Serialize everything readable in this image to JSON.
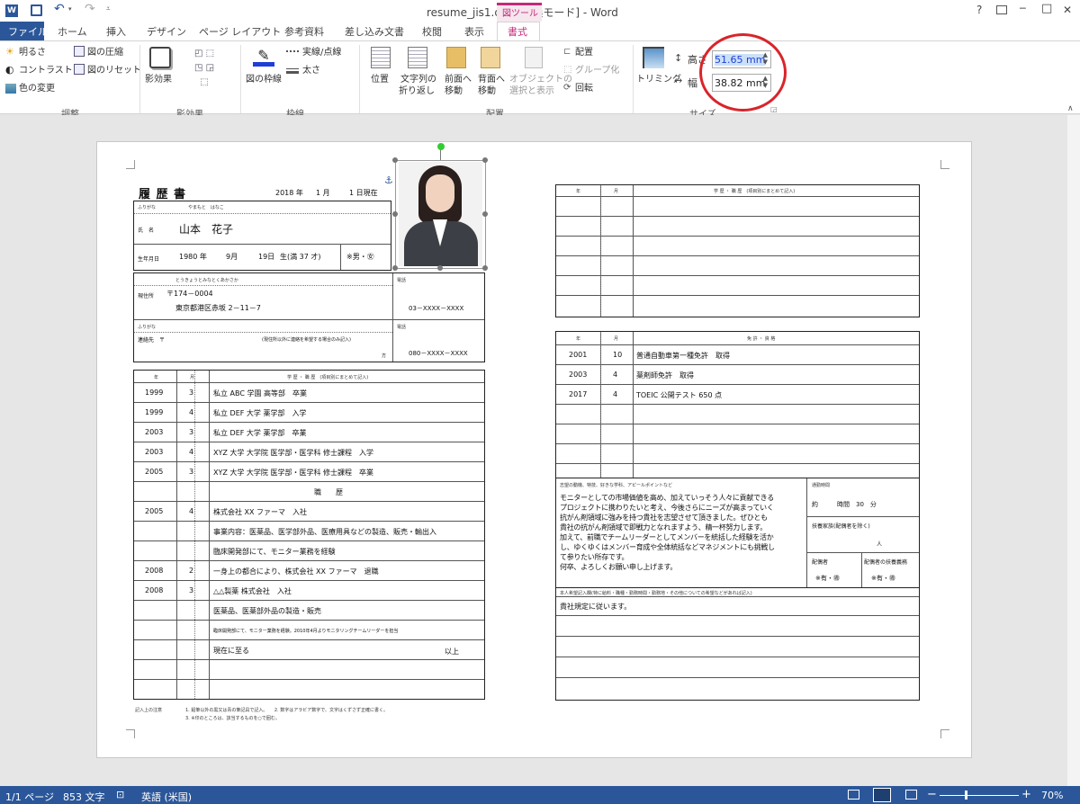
{
  "window": {
    "title": "resume_jis1.doc [互換モード] - Word",
    "help": "?",
    "min": "─",
    "max": "□",
    "close": "✕"
  },
  "tabs": {
    "file": "ファイル",
    "home": "ホーム",
    "insert": "挿入",
    "design": "デザイン",
    "layout": "ページ レイアウト",
    "references": "参考資料",
    "mailings": "差し込み文書",
    "review": "校閲",
    "view": "表示",
    "context": "図ツール",
    "format": "書式"
  },
  "ribbon": {
    "brightness": "明るさ",
    "contrast": "コントラスト",
    "recolor": "色の変更",
    "compress": "図の圧縮",
    "reset": "図のリセット",
    "grp_adjust": "調整",
    "effects": "影効果",
    "grp_shadow": "影効果",
    "border": "図の枠線",
    "line_style": "実線/点線",
    "weight": "太さ",
    "grp_border": "枠線",
    "position": "位置",
    "wrap1": "文字列の",
    "wrap2": "折り返し",
    "fwd1": "前面へ",
    "fwd2": "移動",
    "back1": "背面へ",
    "back2": "移動",
    "sel1": "オブジェクトの",
    "sel2": "選択と表示",
    "align": "配置",
    "group": "グループ化",
    "rotate": "回転",
    "grp_arrange": "配置",
    "crop": "トリミング",
    "height_label": "高さ",
    "width_label": "幅",
    "height_value": "51.65 mm",
    "width_value": "38.82 mm",
    "grp_size": "サイズ"
  },
  "status": {
    "page": "1/1 ページ",
    "words": "853 文字",
    "lang": "英語 (米国)",
    "zoom": "70%"
  },
  "resume": {
    "title": "履 歴 書",
    "date_year": "2018 年",
    "date_month": "1 月",
    "date_day": "1 日現在",
    "furigana_label": "ふりがな",
    "furigana": "やまもと　はなこ",
    "name_label": "氏　名",
    "name": "山本　花子",
    "birth_label": "生年月日",
    "birth_year": "1980 年",
    "birth_month": "9月",
    "birth_day": "19日",
    "birth_age": "生(満 37 才)",
    "gender": "※男・㊛",
    "addr_furi": "とうきょうとみなとくあかさか",
    "addr_label": "現住所",
    "zip": "〒174－0004",
    "address": "東京都港区赤坂 2－11－7",
    "tel_label": "電話",
    "tel": "03－XXXX－XXXX",
    "contact_furi": "ふりがな",
    "contact_label": "連絡先　〒",
    "contact_note": "(現住所以外に連絡を希望する場合のみ記入)",
    "contact_suffix": "方",
    "tel2_label": "電話",
    "tel2": "080－XXXX－XXXX",
    "hist_header": {
      "year": "年",
      "month": "月",
      "content": "学 歴 ・ 職 歴　(項目別にまとめて記入)"
    },
    "history": [
      {
        "y": "1999",
        "m": "3",
        "t": "私立 ABC 学園 高等部　卒業"
      },
      {
        "y": "1999",
        "m": "4",
        "t": "私立 DEF 大学 薬学部　入学"
      },
      {
        "y": "2003",
        "m": "3",
        "t": "私立 DEF 大学 薬学部　卒業"
      },
      {
        "y": "2003",
        "m": "4",
        "t": "XYZ 大学 大学院 医学部・医学科 修士課程　入学"
      },
      {
        "y": "2005",
        "m": "3",
        "t": "XYZ 大学 大学院 医学部・医学科 修士課程　卒業"
      },
      {
        "y": "",
        "m": "",
        "t": "職　　歴"
      },
      {
        "y": "2005",
        "m": "4",
        "t": "株式会社 XX ファーマ　入社"
      },
      {
        "y": "",
        "m": "",
        "t": "事業内容：医薬品、医学部外品、医療用具などの製造、販売・輸出入"
      },
      {
        "y": "",
        "m": "",
        "t": "臨床開発部にて、モニター業務を経験"
      },
      {
        "y": "2008",
        "m": "2",
        "t": "一身上の都合により、株式会社 XX ファーマ　退職"
      },
      {
        "y": "2008",
        "m": "3",
        "t": "△△製薬 株式会社　入社"
      },
      {
        "y": "",
        "m": "",
        "t": "医薬品、医薬部外品の製造・販売"
      },
      {
        "y": "",
        "m": "",
        "t": "臨床開発部にて、モニター業務を経験。2010年4月よりモニタリングチームリーダーを担当"
      },
      {
        "y": "",
        "m": "",
        "t": "現在に至る"
      },
      {
        "y": "",
        "m": "",
        "t": ""
      },
      {
        "y": "",
        "m": "",
        "t": ""
      }
    ],
    "end_label": "以上",
    "note_label": "記入上の注意",
    "note1": "1. 鉛筆以外の黒又は青の筆記具で記入。　　2. 数字はアラビア数字で、文字はくずさず正確に書く。",
    "note2": "3. ※印のところは、該当するものを○で囲む。",
    "r_hist_header": {
      "year": "年",
      "month": "月",
      "content": "学 歴 ・ 職 歴　(項目別にまとめて記入)"
    },
    "lic_header": {
      "year": "年",
      "month": "月",
      "content": "免 許 ・ 資 格"
    },
    "licenses": [
      {
        "y": "2001",
        "m": "10",
        "t": "普通自動車第一種免許　取得"
      },
      {
        "y": "2003",
        "m": "4",
        "t": "薬剤師免許　取得"
      },
      {
        "y": "2017",
        "m": "4",
        "t": "TOEIC 公開テスト 650 点"
      }
    ],
    "motive_label": "志望の動機、特技、好きな学科、アピールポイントなど",
    "motive": [
      "モニターとしての市場価値を高め、加えていっそう人々に貢献できる",
      "プロジェクトに携わりたいと考え、今後さらにニーズが高まっていく",
      "抗がん剤領域に強みを持つ貴社を志望させて頂きました。ぜひとも",
      "貴社の抗がん剤領域で即戦力となれますよう、精一杯努力します。",
      "加えて、前職でチームリーダーとしてメンバーを統括した経験を活か",
      "し、ゆくゆくはメンバー育成や全体統括などマネジメントにも挑戦し",
      "て参りたい所存です。",
      "何卒、よろしくお願い申し上げます。"
    ],
    "commute_label": "通勤時間",
    "commute": "約　　　時間　30　分",
    "dependents_label": "扶養家族(配偶者を除く)",
    "dependents_suffix": "人",
    "spouse_label": "配偶者",
    "spouse_val": "※有・㊜",
    "spouse_dep_label": "配偶者の扶養義務",
    "spouse_dep_val": "※有・㊜",
    "wish_label": "本人希望記入欄(特に給料・職種・勤務時間・勤務地・その他についての希望などがあれば記入)",
    "wish": "貴社規定に従います。"
  },
  "colors": {
    "word_blue": "#2b579a",
    "context_tab": "#c4297b",
    "highlight": "#cbe0f7",
    "circle": "#d9242a"
  }
}
